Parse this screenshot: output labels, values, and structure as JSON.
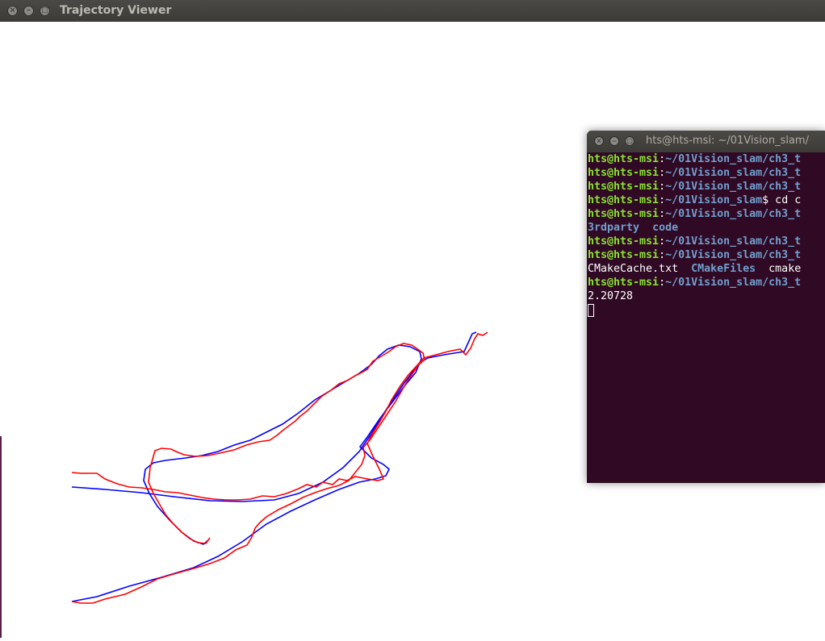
{
  "window": {
    "title": "Trajectory Viewer"
  },
  "colors": {
    "groundtruth": "#0000ff",
    "estimated": "#ff0000",
    "terminal_bg": "#300a24"
  },
  "terminal": {
    "title": "hts@hts-msi: ~/01Vision_slam/",
    "user": "hts@hts-msi",
    "lines": [
      {
        "path": "~/01Vision_slam/ch3_t"
      },
      {
        "path": "~/01Vision_slam/ch3_t"
      },
      {
        "path": "~/01Vision_slam/ch3_t"
      },
      {
        "path": "~/01Vision_slam",
        "cmd": "$ cd c"
      },
      {
        "path": "~/01Vision_slam/ch3_t"
      },
      {
        "listing": [
          "3rdparty",
          "code"
        ]
      },
      {
        "path": "~/01Vision_slam/ch3_t"
      },
      {
        "path": "~/01Vision_slam/ch3_t"
      },
      {
        "listing_mixed": [
          "CMakeCache.txt",
          "CMakeFiles",
          "cmake"
        ]
      },
      {
        "path": "~/01Vision_slam/ch3_t"
      }
    ],
    "output": "2.20728"
  }
}
